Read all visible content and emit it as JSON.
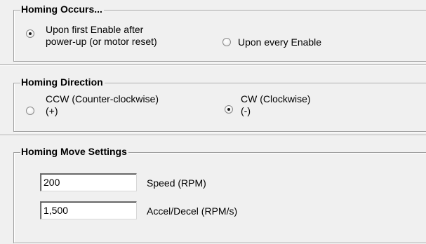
{
  "homing_occurs": {
    "title": "Homing Occurs...",
    "options": [
      {
        "line1": "Upon first Enable after",
        "line2": "power-up (or motor reset)",
        "checked": true
      },
      {
        "line1": "Upon every Enable",
        "line2": "",
        "checked": false
      }
    ]
  },
  "homing_direction": {
    "title": "Homing Direction",
    "options": [
      {
        "line1": "CCW (Counter-clockwise)",
        "line2": "(+)",
        "checked": false
      },
      {
        "line1": "CW (Clockwise)",
        "line2": "(-)",
        "checked": true
      }
    ]
  },
  "homing_move": {
    "title": "Homing Move Settings",
    "speed": {
      "value": "200",
      "label": "Speed (RPM)"
    },
    "accel": {
      "value": "1,500",
      "label": "Accel/Decel (RPM/s)"
    }
  }
}
